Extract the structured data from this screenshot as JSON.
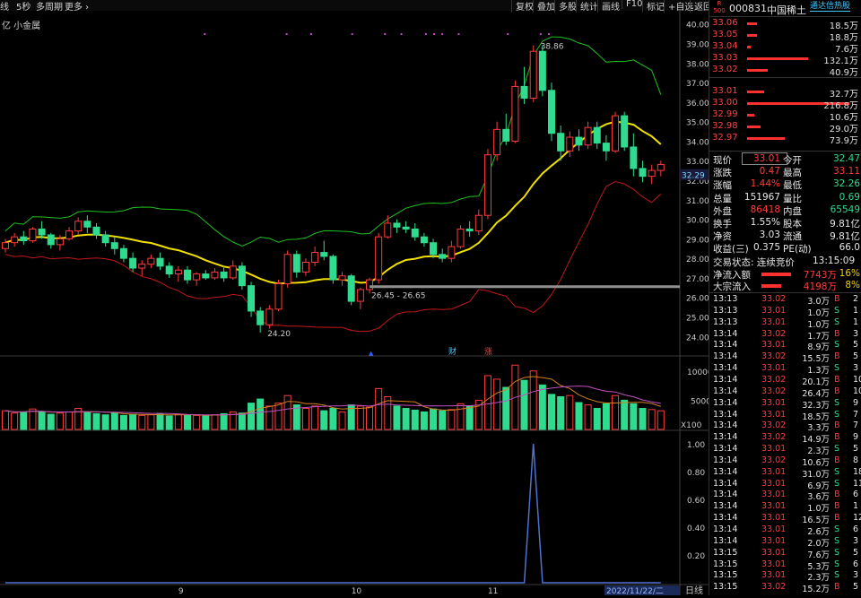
{
  "toolbar": {
    "left": [
      "线",
      "5秒",
      "多周期",
      "更多 ›"
    ],
    "right": [
      "复权",
      "叠加",
      "多股",
      "统计",
      "画线",
      "F10",
      "标记",
      "+自选",
      "返回"
    ]
  },
  "chart": {
    "indicator_label": "亿 小金属",
    "price_axis": [
      "40.00",
      "39.00",
      "38.00",
      "37.00",
      "36.00",
      "35.00",
      "34.00",
      "33.00",
      "32.00",
      "31.00",
      "30.00",
      "29.00",
      "28.00",
      "27.00",
      "26.00",
      "25.00",
      "24.00"
    ],
    "current_price_tag": "32.29",
    "high_annotation": "38.86",
    "low_annotation": "24.20",
    "range_annotation": "26.45 - 26.65",
    "event_marker_cai": "财",
    "event_marker_zhang": "涨",
    "volume_axis": [
      "10000",
      "5000"
    ],
    "volume_unit": "X100",
    "osc_axis": [
      "1.00",
      "0.80",
      "0.60",
      "0.40",
      "0.20"
    ],
    "date_labels": [
      "9",
      "10",
      "11"
    ],
    "current_date": "2022/11/22/二",
    "period_label": "日线",
    "colors": {
      "up": "#ff3b3b",
      "down": "#2fdc8f",
      "ma": "#f0e000",
      "band_up": "#1fc01f",
      "band_dn": "#c01818",
      "vol_ma1": "#d08020",
      "vol_ma2": "#c050c0"
    }
  },
  "stock": {
    "code": "000831",
    "name": "中国稀土",
    "badge_top": "R",
    "badge_bottom": "500",
    "hot_link": "通达信热股"
  },
  "orderbook": {
    "asks": [
      {
        "price": "33.06",
        "volume": "18.5万",
        "size": 3
      },
      {
        "price": "33.05",
        "volume": "18.8万",
        "size": 3
      },
      {
        "price": "33.04",
        "volume": "7.6万",
        "size": 1
      },
      {
        "price": "33.03",
        "volume": "132.1万",
        "size": 18
      },
      {
        "price": "33.02",
        "volume": "40.9万",
        "size": 6
      }
    ],
    "bids": [
      {
        "price": "33.01",
        "volume": "32.7万",
        "size": 5
      },
      {
        "price": "33.00",
        "volume": "216.8万",
        "size": 30
      },
      {
        "price": "32.99",
        "volume": "10.6万",
        "size": 2
      },
      {
        "price": "32.98",
        "volume": "29.0万",
        "size": 4
      },
      {
        "price": "32.97",
        "volume": "73.9万",
        "size": 11
      }
    ]
  },
  "quote": {
    "rows": [
      {
        "l1": "现价",
        "v1": "33.01",
        "l2": "今开",
        "v2": "32.47"
      },
      {
        "l1": "涨跌",
        "v1": "0.47",
        "l2": "最高",
        "v2": "33.11"
      },
      {
        "l1": "涨幅",
        "v1": "1.44%",
        "l2": "最低",
        "v2": "32.26"
      },
      {
        "l1": "总量",
        "v1": "151967",
        "l2": "量比",
        "v2": "0.69"
      },
      {
        "l1": "外盘",
        "v1": "86418",
        "l2": "内盘",
        "v2": "65549"
      },
      {
        "l1": "换手",
        "v1": "1.55%",
        "l2": "股本",
        "v2": "9.81亿"
      },
      {
        "l1": "净资",
        "v1": "3.03",
        "l2": "流通",
        "v2": "9.81亿"
      },
      {
        "l1": "收益(三)",
        "v1": "0.375",
        "l2": "PE(动)",
        "v2": "66.0"
      }
    ],
    "trade_status_label": "交易状态: 连续竞价",
    "trade_status_time": "13:15:09",
    "inflow": [
      {
        "label": "净流入额",
        "value": "7743万",
        "pct": "16%"
      },
      {
        "label": "大宗流入",
        "value": "4198万",
        "pct": "8%"
      }
    ]
  },
  "ticks": [
    {
      "t": "13:13",
      "p": "33.02",
      "v": "3.0万",
      "s": "B",
      "n": "2"
    },
    {
      "t": "13:13",
      "p": "33.01",
      "v": "1.0万",
      "s": "S",
      "n": "1"
    },
    {
      "t": "13:13",
      "p": "33.01",
      "v": "1.0万",
      "s": "S",
      "n": "1"
    },
    {
      "t": "13:14",
      "p": "33.02",
      "v": "1.7万",
      "s": "B",
      "n": "3"
    },
    {
      "t": "13:14",
      "p": "33.01",
      "v": "8.9万",
      "s": "S",
      "n": "5"
    },
    {
      "t": "13:14",
      "p": "33.02",
      "v": "15.5万",
      "s": "B",
      "n": "5"
    },
    {
      "t": "13:14",
      "p": "33.01",
      "v": "1.3万",
      "s": "S",
      "n": "3"
    },
    {
      "t": "13:14",
      "p": "33.02",
      "v": "20.1万",
      "s": "B",
      "n": "10"
    },
    {
      "t": "13:14",
      "p": "33.02",
      "v": "26.4万",
      "s": "B",
      "n": "10"
    },
    {
      "t": "13:14",
      "p": "33.01",
      "v": "32.3万",
      "s": "S",
      "n": "9"
    },
    {
      "t": "13:14",
      "p": "33.01",
      "v": "18.5万",
      "s": "S",
      "n": "7"
    },
    {
      "t": "13:14",
      "p": "33.02",
      "v": "3.3万",
      "s": "B",
      "n": "7"
    },
    {
      "t": "13:14",
      "p": "33.02",
      "v": "14.9万",
      "s": "B",
      "n": "9"
    },
    {
      "t": "13:14",
      "p": "33.01",
      "v": "2.3万",
      "s": "S",
      "n": "5"
    },
    {
      "t": "13:14",
      "p": "33.02",
      "v": "10.6万",
      "s": "B",
      "n": "8"
    },
    {
      "t": "13:14",
      "p": "33.01",
      "v": "31.0万",
      "s": "S",
      "n": "18"
    },
    {
      "t": "13:14",
      "p": "33.01",
      "v": "6.9万",
      "s": "S",
      "n": "11"
    },
    {
      "t": "13:14",
      "p": "33.01",
      "v": "3.6万",
      "s": "B",
      "n": "6"
    },
    {
      "t": "13:14",
      "p": "33.01",
      "v": "1.0万",
      "s": "B",
      "n": "1"
    },
    {
      "t": "13:14",
      "p": "33.01",
      "v": "16.5万",
      "s": "B",
      "n": "12"
    },
    {
      "t": "13:14",
      "p": "33.01",
      "v": "2.6万",
      "s": "S",
      "n": "6"
    },
    {
      "t": "13:14",
      "p": "33.01",
      "v": "2.0万",
      "s": "S",
      "n": "3"
    },
    {
      "t": "13:15",
      "p": "33.01",
      "v": "7.6万",
      "s": "S",
      "n": "5"
    },
    {
      "t": "13:15",
      "p": "33.01",
      "v": "5.3万",
      "s": "S",
      "n": "6"
    },
    {
      "t": "13:15",
      "p": "33.01",
      "v": "2.3万",
      "s": "S",
      "n": "3"
    },
    {
      "t": "13:15",
      "p": "33.02",
      "v": "15.2万",
      "s": "B",
      "n": "5"
    }
  ],
  "chart_data": {
    "type": "candlestick",
    "candles": [
      [
        28.5,
        29.0,
        28.3,
        28.8
      ],
      [
        28.8,
        29.3,
        28.6,
        29.1
      ],
      [
        29.1,
        29.4,
        28.7,
        28.9
      ],
      [
        28.9,
        29.6,
        28.8,
        29.5
      ],
      [
        29.5,
        29.9,
        29.0,
        29.2
      ],
      [
        29.2,
        29.3,
        28.5,
        28.7
      ],
      [
        28.7,
        29.2,
        28.4,
        29.0
      ],
      [
        29.0,
        29.6,
        28.9,
        29.4
      ],
      [
        29.4,
        30.1,
        29.2,
        29.9
      ],
      [
        29.9,
        30.2,
        29.3,
        29.6
      ],
      [
        29.6,
        29.8,
        29.0,
        29.2
      ],
      [
        29.2,
        29.4,
        28.6,
        28.8
      ],
      [
        28.8,
        29.1,
        28.2,
        28.5
      ],
      [
        28.5,
        28.7,
        27.8,
        28.0
      ],
      [
        28.0,
        28.3,
        27.3,
        27.5
      ],
      [
        27.5,
        27.9,
        27.1,
        27.7
      ],
      [
        27.7,
        28.2,
        27.5,
        28.0
      ],
      [
        28.0,
        28.3,
        27.4,
        27.6
      ],
      [
        27.6,
        27.8,
        27.0,
        27.2
      ],
      [
        27.2,
        27.6,
        26.8,
        27.4
      ],
      [
        27.4,
        27.6,
        26.7,
        26.9
      ],
      [
        26.9,
        27.3,
        26.6,
        27.2
      ],
      [
        27.2,
        27.4,
        26.9,
        27.0
      ],
      [
        27.0,
        27.5,
        26.9,
        27.3
      ],
      [
        27.3,
        27.6,
        26.8,
        27.0
      ],
      [
        27.0,
        27.9,
        26.9,
        27.6
      ],
      [
        27.6,
        27.8,
        26.4,
        26.6
      ],
      [
        26.6,
        26.8,
        25.0,
        25.3
      ],
      [
        25.3,
        25.5,
        24.2,
        24.6
      ],
      [
        24.6,
        25.6,
        24.4,
        25.4
      ],
      [
        25.4,
        26.9,
        25.3,
        26.7
      ],
      [
        26.7,
        28.4,
        26.5,
        28.2
      ],
      [
        28.2,
        28.4,
        27.0,
        27.3
      ],
      [
        27.3,
        28.0,
        27.1,
        27.8
      ],
      [
        27.8,
        28.6,
        27.6,
        28.3
      ],
      [
        28.3,
        28.9,
        27.9,
        28.1
      ],
      [
        28.1,
        28.2,
        26.7,
        26.9
      ],
      [
        26.9,
        27.3,
        26.6,
        27.1
      ],
      [
        27.1,
        27.2,
        25.6,
        25.8
      ],
      [
        25.8,
        26.5,
        25.4,
        26.4
      ],
      [
        26.4,
        27.0,
        26.2,
        26.9
      ],
      [
        26.9,
        29.3,
        26.7,
        29.1
      ],
      [
        29.1,
        30.2,
        29.0,
        29.8
      ],
      [
        29.8,
        30.0,
        29.3,
        29.6
      ],
      [
        29.6,
        29.9,
        29.3,
        29.5
      ],
      [
        29.5,
        29.8,
        28.9,
        29.1
      ],
      [
        29.1,
        29.3,
        28.6,
        28.8
      ],
      [
        28.8,
        29.0,
        28.0,
        28.2
      ],
      [
        28.2,
        28.5,
        27.8,
        28.0
      ],
      [
        28.0,
        28.9,
        27.8,
        28.6
      ],
      [
        28.6,
        29.7,
        28.5,
        29.5
      ],
      [
        29.5,
        29.9,
        29.1,
        29.4
      ],
      [
        29.4,
        30.5,
        29.2,
        30.2
      ],
      [
        30.2,
        33.6,
        30.0,
        33.3
      ],
      [
        33.3,
        35.0,
        33.0,
        34.6
      ],
      [
        34.6,
        35.4,
        33.8,
        34.0
      ],
      [
        34.0,
        37.1,
        33.9,
        36.8
      ],
      [
        36.8,
        37.8,
        35.9,
        36.2
      ],
      [
        36.2,
        38.9,
        36.0,
        38.6
      ],
      [
        38.6,
        38.9,
        36.3,
        36.6
      ],
      [
        36.6,
        37.0,
        34.0,
        34.4
      ],
      [
        34.4,
        34.8,
        33.0,
        33.5
      ],
      [
        33.5,
        34.5,
        33.2,
        34.2
      ],
      [
        34.2,
        34.6,
        33.5,
        33.8
      ],
      [
        33.8,
        35.0,
        33.6,
        34.7
      ],
      [
        34.7,
        35.0,
        33.6,
        33.9
      ],
      [
        33.9,
        34.3,
        33.0,
        33.5
      ],
      [
        33.5,
        35.5,
        33.4,
        35.3
      ],
      [
        35.3,
        35.5,
        33.5,
        33.7
      ],
      [
        33.7,
        34.4,
        32.2,
        32.6
      ],
      [
        32.6,
        33.0,
        31.9,
        32.2
      ],
      [
        32.2,
        32.8,
        31.8,
        32.5
      ],
      [
        32.5,
        33.0,
        32.2,
        32.8
      ]
    ],
    "vol": [
      32,
      28,
      30,
      35,
      30,
      26,
      28,
      30,
      36,
      30,
      27,
      25,
      28,
      24,
      26,
      24,
      25,
      27,
      23,
      26,
      25,
      24,
      23,
      25,
      27,
      30,
      28,
      45,
      52,
      40,
      45,
      58,
      42,
      36,
      40,
      32,
      36,
      30,
      42,
      40,
      38,
      70,
      56,
      40,
      36,
      33,
      30,
      35,
      32,
      34,
      44,
      40,
      50,
      92,
      86,
      72,
      110,
      84,
      100,
      76,
      60,
      56,
      58,
      46,
      42,
      36,
      44,
      58,
      50,
      44,
      36,
      34,
      32
    ],
    "osc_peak_index": 58,
    "osc_peak_value": 1.0
  }
}
